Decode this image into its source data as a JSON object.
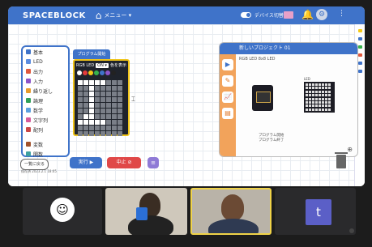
{
  "app": {
    "logo": "SPACEBLOCK",
    "menu_label": "メニュー ▾",
    "device_label": "デバイス切替"
  },
  "categories": [
    {
      "label": "基本",
      "color": "#3f73c9"
    },
    {
      "label": "LED",
      "color": "#5b8ce0"
    },
    {
      "label": "出力",
      "color": "#e0593e"
    },
    {
      "label": "入力",
      "color": "#8c54c9"
    },
    {
      "label": "繰り返し",
      "color": "#e89c2c"
    },
    {
      "label": "論理",
      "color": "#2fa05a"
    },
    {
      "label": "数学",
      "color": "#5ba0e0"
    },
    {
      "label": "文字列",
      "color": "#d65a9b"
    },
    {
      "label": "配列",
      "color": "#c94646"
    },
    {
      "label": "変数",
      "color": "#a0522d"
    },
    {
      "label": "関数",
      "color": "#3fa0a0"
    }
  ],
  "block": {
    "header": "プログラム開始",
    "row_label": "RGB LED",
    "select_value": "ON ▾",
    "color_label": "色を表示",
    "palette": [
      "#ffffff",
      "#e33b3b",
      "#f6c915",
      "#37b24d",
      "#3f73c9",
      "#8c54c9",
      "#222222"
    ],
    "matrix": [
      [
        1,
        1,
        1,
        1,
        1,
        0,
        0,
        0
      ],
      [
        0,
        0,
        1,
        0,
        0,
        0,
        0,
        0
      ],
      [
        0,
        0,
        1,
        0,
        0,
        0,
        0,
        0
      ],
      [
        0,
        0,
        1,
        0,
        0,
        0,
        0,
        0
      ],
      [
        0,
        0,
        1,
        0,
        0,
        0,
        0,
        0
      ],
      [
        0,
        0,
        1,
        0,
        0,
        0,
        0,
        0
      ],
      [
        0,
        1,
        1,
        0,
        0,
        0,
        0,
        0
      ],
      [
        1,
        1,
        1,
        1,
        1,
        0,
        0,
        0
      ],
      [
        0,
        0,
        0,
        0,
        0,
        0,
        0,
        0
      ],
      [
        0,
        0,
        0,
        0,
        0,
        0,
        0,
        0
      ]
    ]
  },
  "simulator": {
    "title": "新しいプロジェクト 01",
    "tabs": [
      "シミュレーター",
      "編集",
      "グラフ",
      "ログ"
    ],
    "device_text": "RGB LED 8x8 LED",
    "led_label": "LED",
    "footer_line1": "プログラム開始",
    "footer_line2": "プログラム終了"
  },
  "controls": {
    "back_label": "一覧に戻る",
    "caption": "保存済 2023.2.1 18:05",
    "run_label": "実行 ▶",
    "stop_label": "中止 ⊘"
  },
  "video": {
    "tile4_initial": "t"
  }
}
